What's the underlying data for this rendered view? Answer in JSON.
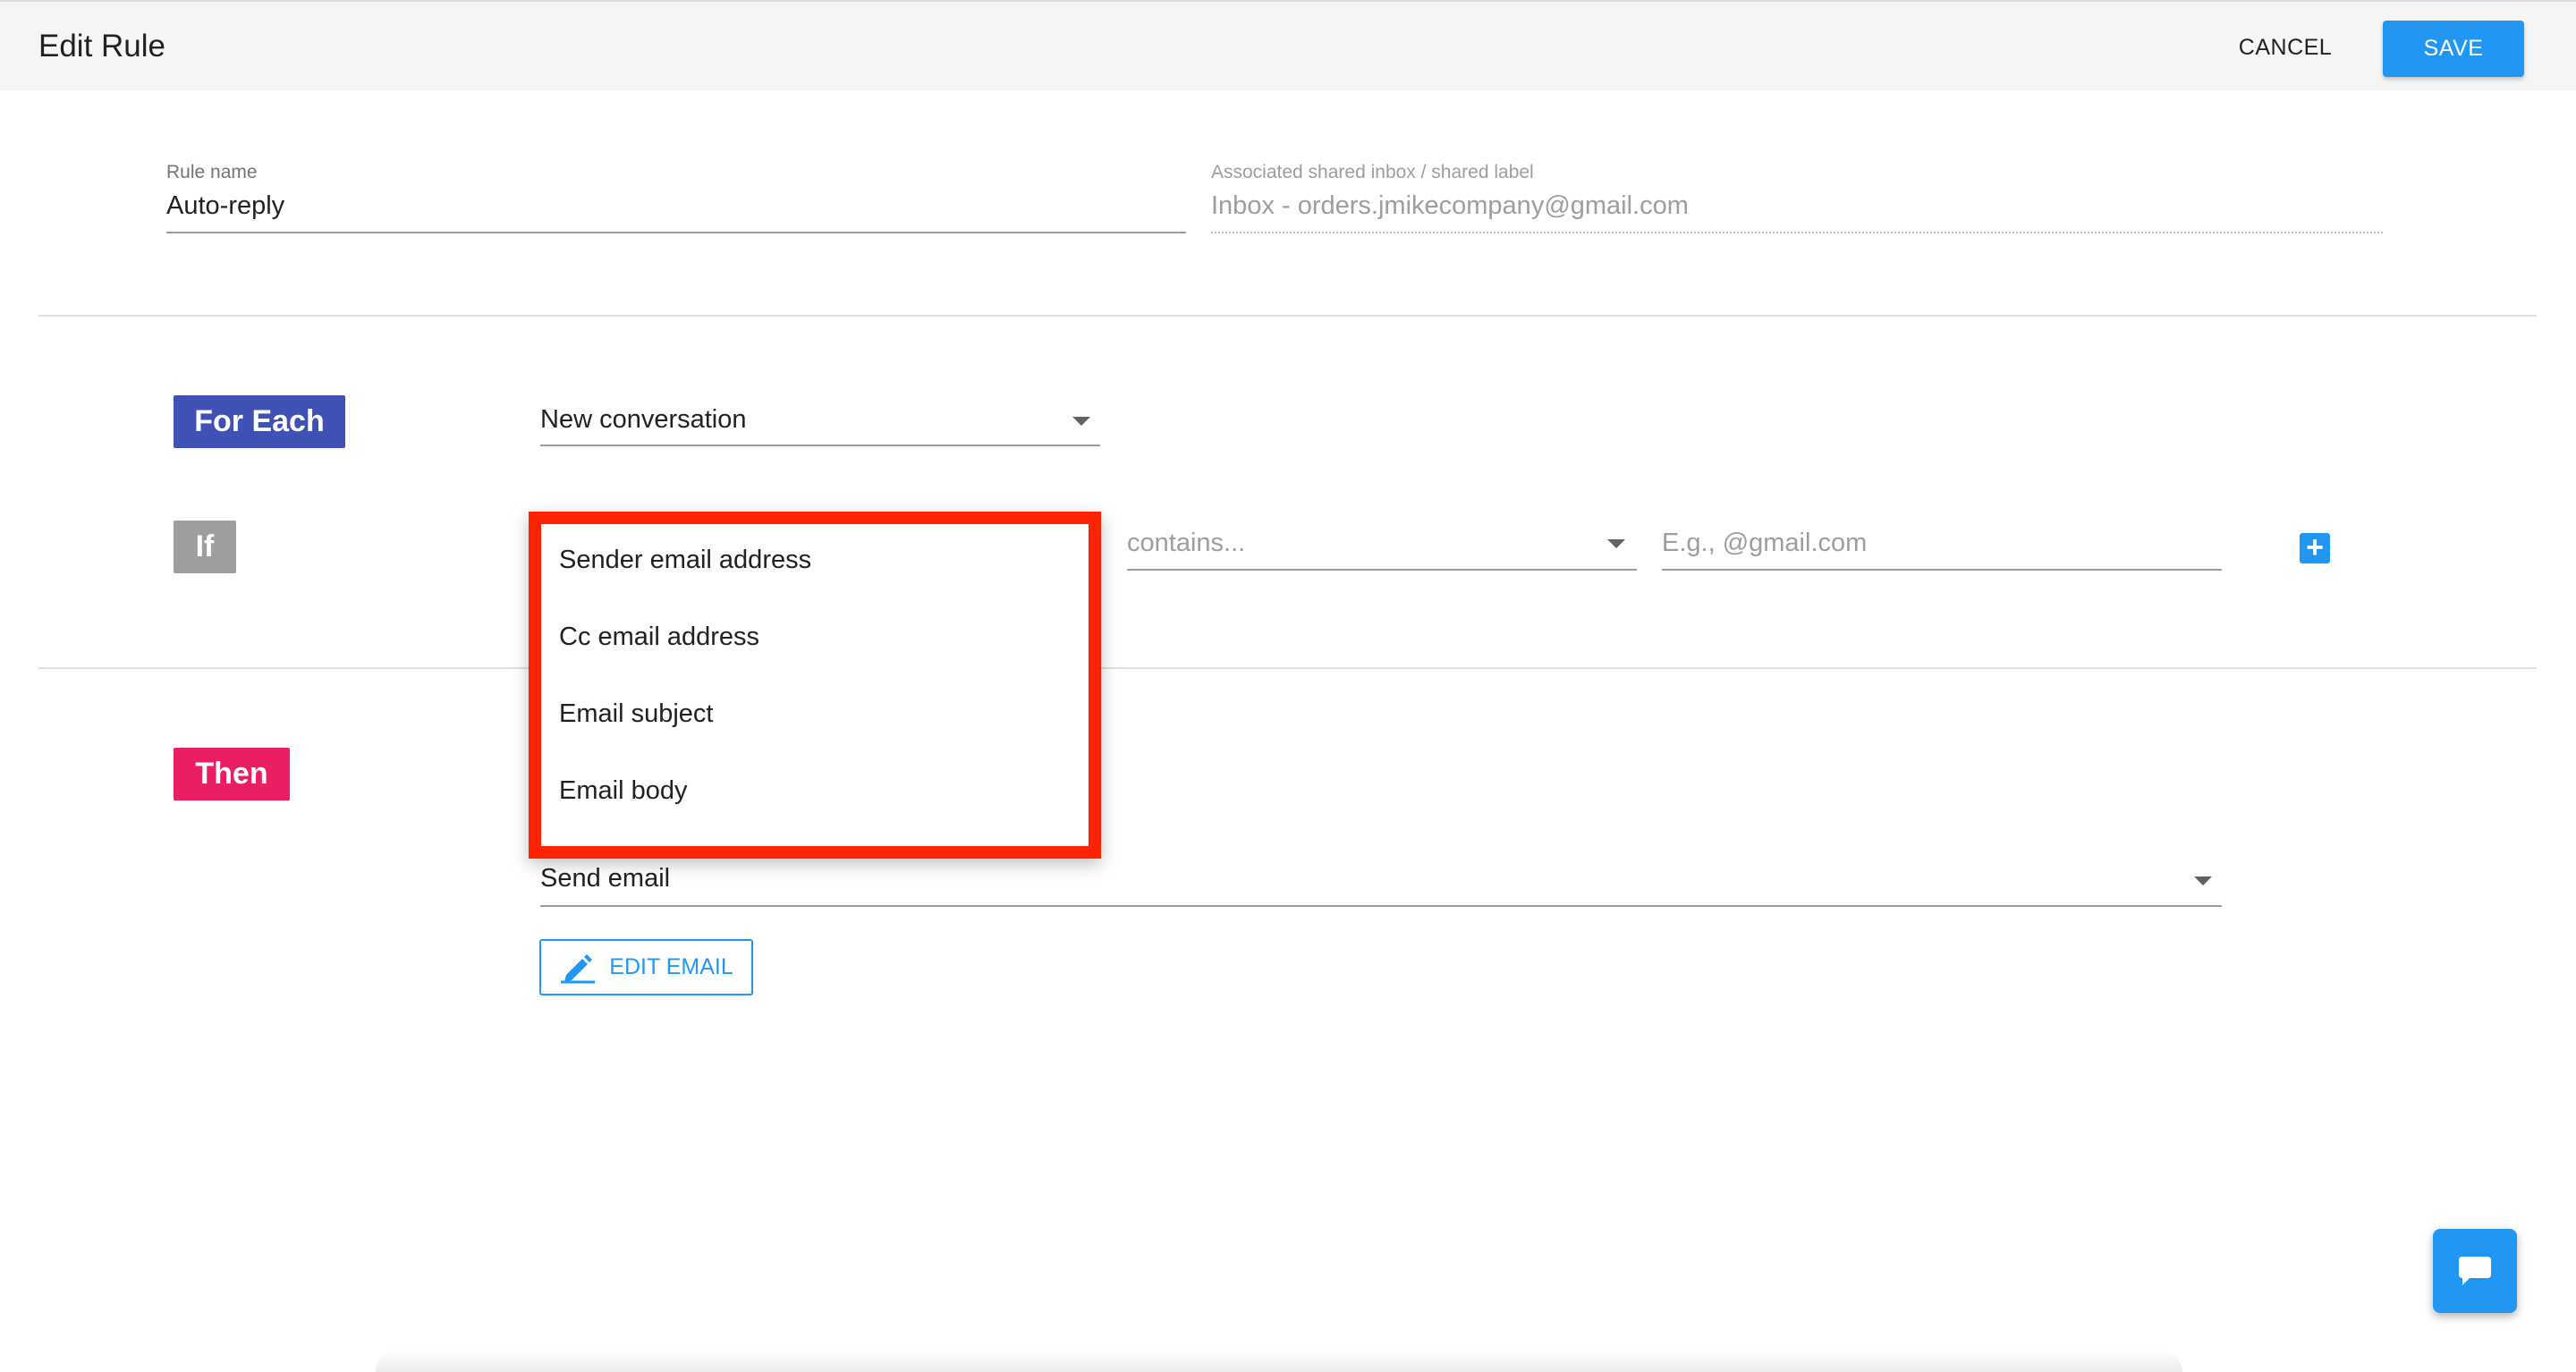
{
  "header": {
    "title": "Edit Rule",
    "cancel_label": "CANCEL",
    "save_label": "SAVE"
  },
  "rule_name": {
    "label": "Rule name",
    "value": "Auto-reply"
  },
  "shared_inbox": {
    "label": "Associated shared inbox / shared label",
    "value": "Inbox - orders.jmikecompany@gmail.com"
  },
  "for_each": {
    "tag": "For Each",
    "selected": "New conversation"
  },
  "if_condition": {
    "tag": "If",
    "operator_placeholder": "contains...",
    "value_placeholder": "E.g., @gmail.com",
    "dropdown_options": [
      "Sender email address",
      "Cc email address",
      "Email subject",
      "Email body"
    ]
  },
  "then_action": {
    "tag": "Then",
    "selected": "Send email",
    "edit_email_label": "EDIT EMAIL"
  },
  "colors": {
    "accent": "#2196f3",
    "for_each_tag": "#3f51b5",
    "if_tag": "#9e9e9e",
    "then_tag": "#e91e63",
    "dropdown_highlight": "#ff2400"
  },
  "icons": {
    "add": "plus-icon",
    "edit_email": "edit-pen-icon",
    "chat": "chat-bubble-icon"
  }
}
